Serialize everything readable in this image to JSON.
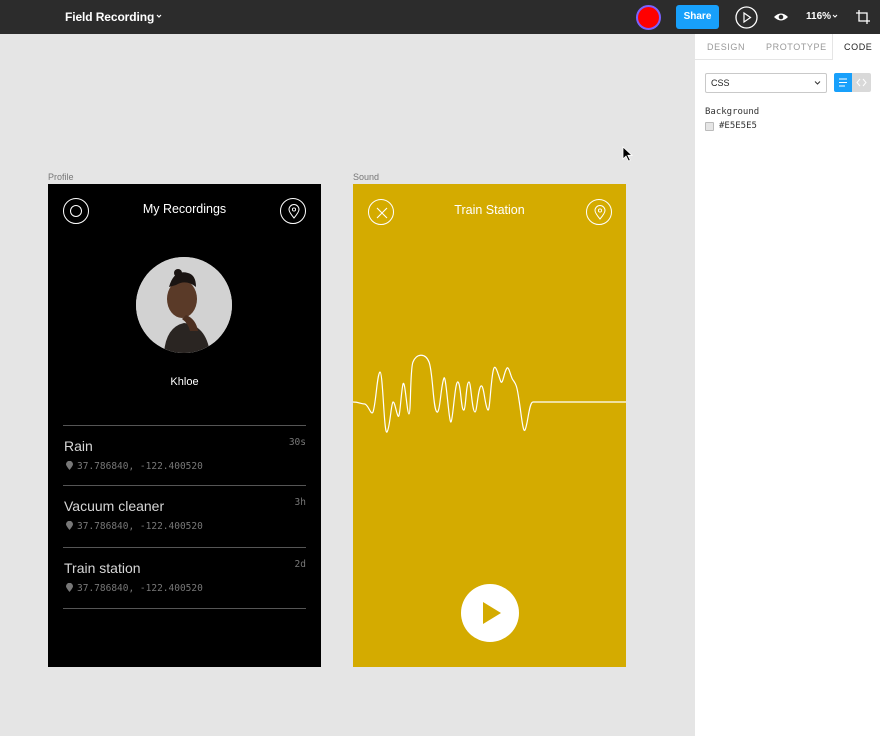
{
  "toolbar": {
    "file_title": "Field Recording",
    "share_label": "Share",
    "zoom_level": "116%",
    "recording_color": "#ff0000"
  },
  "panel": {
    "tabs": [
      {
        "label": "DESIGN"
      },
      {
        "label": "PROTOTYPE"
      },
      {
        "label": "CODE"
      }
    ],
    "active_tab": "CODE",
    "language": "CSS",
    "background_label": "Background",
    "background_hex": "#E5E5E5"
  },
  "canvas": {
    "background_color": "#e5e5e5"
  },
  "profile": {
    "frame_label": "Profile",
    "title": "My Recordings",
    "user_name": "Khloe",
    "recordings": [
      {
        "title": "Rain",
        "coords": "37.786840, -122.400520",
        "duration": "30s"
      },
      {
        "title": "Vacuum cleaner",
        "coords": "37.786840, -122.400520",
        "duration": "3h"
      },
      {
        "title": "Train station",
        "coords": "37.786840, -122.400520",
        "duration": "2d"
      }
    ]
  },
  "sound": {
    "frame_label": "Sound",
    "title": "Train Station",
    "accent_color": "#d4ab00"
  }
}
